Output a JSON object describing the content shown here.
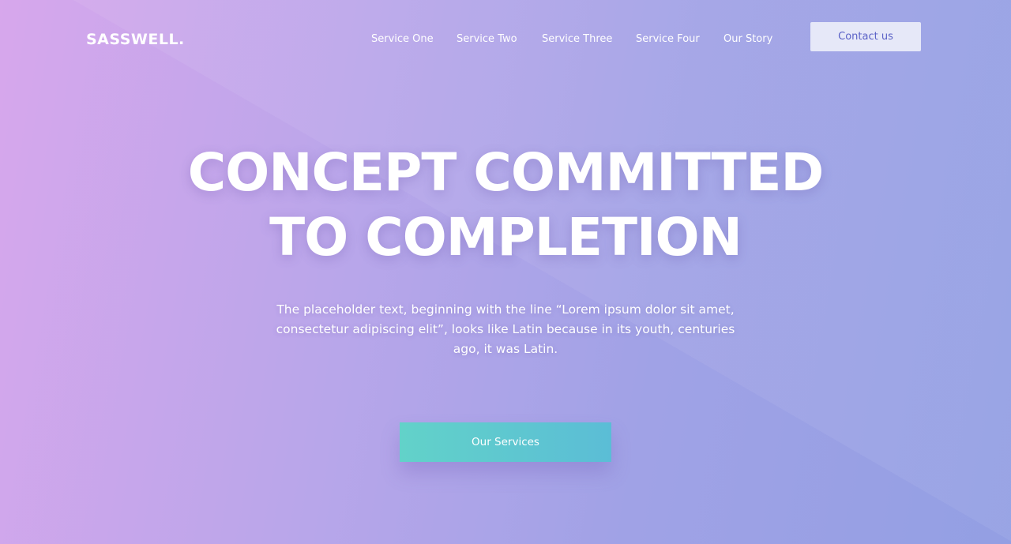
{
  "brand": {
    "logo_text": "SASSWELL."
  },
  "nav": {
    "items": [
      {
        "label": "Service One"
      },
      {
        "label": "Service Two"
      },
      {
        "label": "Service Three"
      },
      {
        "label": "Service Four"
      },
      {
        "label": "Our Story"
      }
    ],
    "contact_label": "Contact us"
  },
  "hero": {
    "headline_line1": "CONCEPT COMMITTED",
    "headline_line2": "TO COMPLETION",
    "subtitle": "The placeholder text, beginning with the line “Lorem ipsum dolor sit amet, consectetur adipiscing elit”, looks like Latin because in its youth, centuries ago, it was Latin.",
    "cta_label": "Our Services"
  },
  "colors": {
    "gradient_start": "#d7a7ec",
    "gradient_end": "#939fe3",
    "contact_button_bg": "#e6e8f8",
    "contact_button_text": "#5b62c7",
    "cta_start": "#62d2c9",
    "cta_end": "#5bbdd6"
  }
}
